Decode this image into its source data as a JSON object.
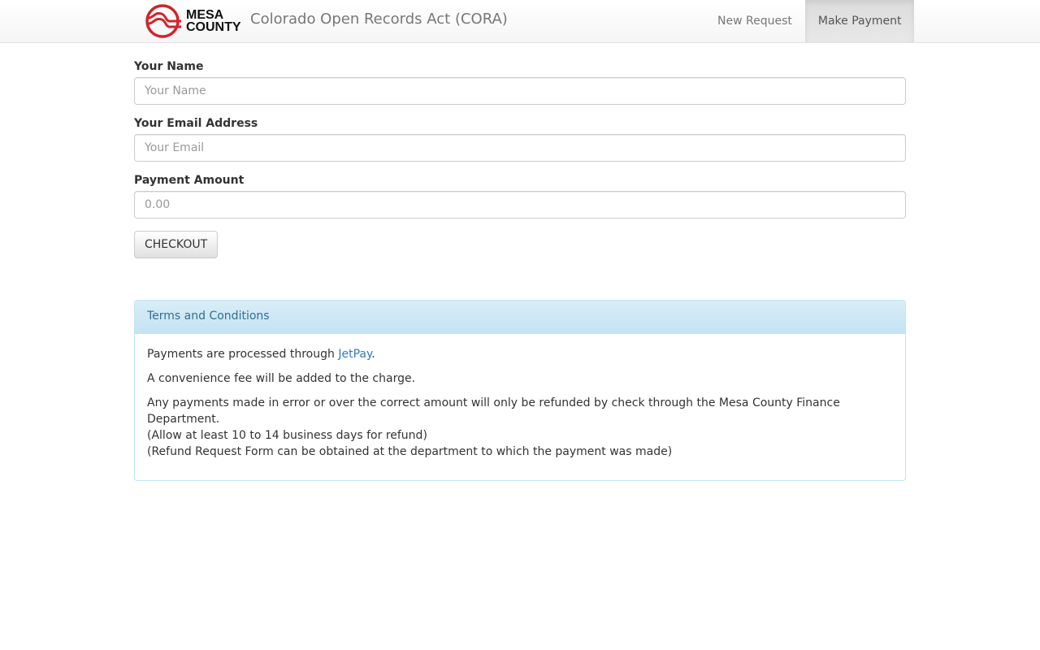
{
  "header": {
    "logo": {
      "line1": "MESA",
      "line2": "COUNTY"
    },
    "title": "Colorado Open Records Act (CORA)",
    "nav": [
      {
        "label": "New Request"
      },
      {
        "label": "Make Payment"
      }
    ]
  },
  "form": {
    "name": {
      "label": "Your Name",
      "placeholder": "Your Name",
      "value": ""
    },
    "email": {
      "label": "Your Email Address",
      "placeholder": "Your Email",
      "value": ""
    },
    "amount": {
      "label": "Payment Amount",
      "placeholder": "0.00",
      "value": ""
    },
    "checkout_label": "CHECKOUT"
  },
  "terms": {
    "heading": "Terms and Conditions",
    "p1_prefix": "Payments are processed through ",
    "p1_link": "JetPay",
    "p1_suffix": ".",
    "p2": "A convenience fee will be added to the charge.",
    "p3_line1": "Any payments made in error or over the correct amount will only be refunded by check through the Mesa County Finance Department.",
    "p3_line2": "(Allow at least 10 to 14 business days for refund)",
    "p3_line3": "(Refund Request Form can be obtained at the department to which the payment was made)"
  },
  "colors": {
    "logo_red": "#d2232a",
    "link": "#337ab7",
    "panel_heading_text": "#31708f"
  }
}
